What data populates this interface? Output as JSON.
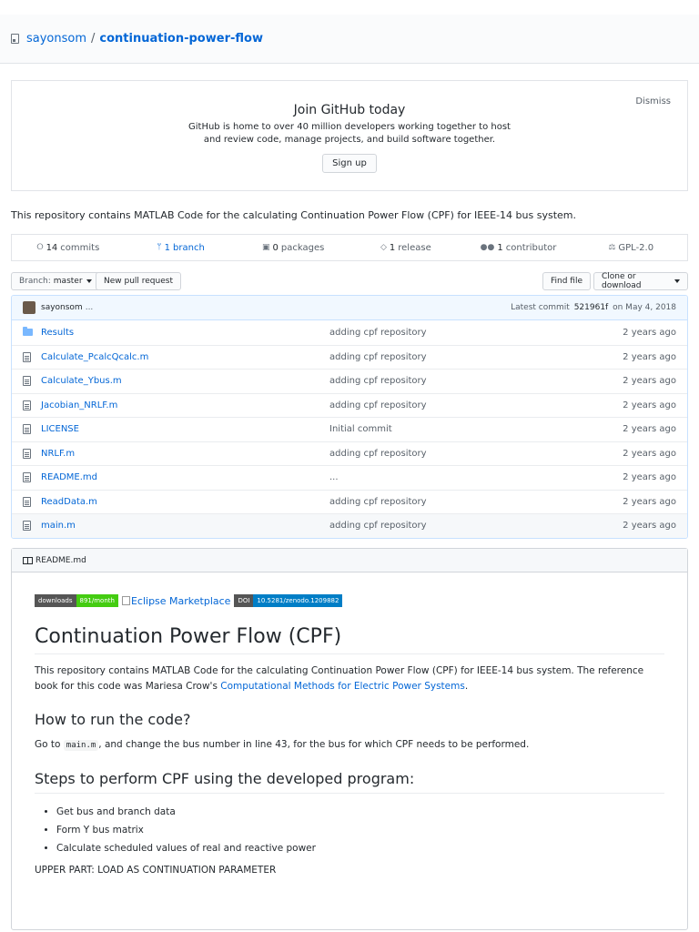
{
  "repo": {
    "owner": "sayonsom",
    "separator": "/",
    "name": "continuation-power-flow"
  },
  "signup": {
    "title": "Join GitHub today",
    "line1": "GitHub is home to over 40 million developers working together to host",
    "line2": "and review code, manage projects, and build software together.",
    "button": "Sign up",
    "dismiss": "Dismiss"
  },
  "description": "This repository contains MATLAB Code for the calculating Continuation Power Flow (CPF) for IEEE-14 bus system.",
  "numbers": {
    "commits_count": "14",
    "commits_label": "commits",
    "branch_count": "1",
    "branch_label": "branch",
    "packages_count": "0",
    "packages_label": "packages",
    "release_count": "1",
    "release_label": "release",
    "contributor_count": "1",
    "contributor_label": "contributor",
    "license": "GPL-2.0"
  },
  "filenav": {
    "branch_prefix": "Branch:",
    "branch_name": "master",
    "new_pr": "New pull request",
    "find_file": "Find file",
    "clone": "Clone or download"
  },
  "commit": {
    "author": "sayonsom",
    "ellipsis": "...",
    "latest_label": "Latest commit",
    "sha": "521961f",
    "date": "on May 4, 2018"
  },
  "files": [
    {
      "name": "Results",
      "message": "adding cpf repository",
      "age": "2 years ago",
      "icon": "folder-icon"
    },
    {
      "name": "Calculate_PcalcQcalc.m",
      "message": "adding cpf repository",
      "age": "2 years ago",
      "icon": "file-icon"
    },
    {
      "name": "Calculate_Ybus.m",
      "message": "adding cpf repository",
      "age": "2 years ago",
      "icon": "file-icon"
    },
    {
      "name": "Jacobian_NRLF.m",
      "message": "adding cpf repository",
      "age": "2 years ago",
      "icon": "file-icon"
    },
    {
      "name": "LICENSE",
      "message": "Initial commit",
      "age": "2 years ago",
      "icon": "file-icon"
    },
    {
      "name": "NRLF.m",
      "message": "adding cpf repository",
      "age": "2 years ago",
      "icon": "file-icon"
    },
    {
      "name": "README.md",
      "message": "...",
      "age": "2 years ago",
      "icon": "file-icon"
    },
    {
      "name": "ReadData.m",
      "message": "adding cpf repository",
      "age": "2 years ago",
      "icon": "file-icon"
    },
    {
      "name": "main.m",
      "message": "adding cpf repository",
      "age": "2 years ago",
      "icon": "file-icon"
    }
  ],
  "readme": {
    "header": "README.md",
    "badge_downloads_label": "downloads",
    "badge_downloads_value": "891/month",
    "eclipse_alt": "Eclipse Marketplace",
    "badge_doi_label": "DOI",
    "badge_doi_value": "10.5281/zenodo.1209882",
    "h1": "Continuation Power Flow (CPF)",
    "p1_text": "This repository contains MATLAB Code for the calculating Continuation Power Flow (CPF) for IEEE-14 bus system. The reference book for this code was Mariesa Crow's ",
    "p1_link": "Computational Methods for Electric Power Systems",
    "p1_end": ".",
    "h2_run": "How to run the code?",
    "p2_pre": "Go to ",
    "p2_code": "main.m",
    "p2_post": ", and change the bus number in line 43, for the bus for which CPF needs to be performed.",
    "h2_steps": "Steps to perform CPF using the developed program:",
    "steps": [
      "Get bus and branch data",
      "Form Y bus matrix",
      "Calculate scheduled values of real and reactive power"
    ],
    "upper": "UPPER PART: LOAD AS CONTINUATION PARAMETER"
  }
}
